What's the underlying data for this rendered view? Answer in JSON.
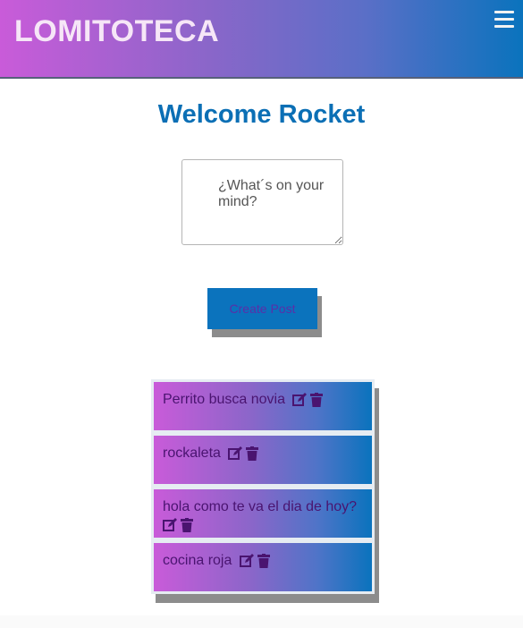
{
  "header": {
    "brand": "LOMITOTECA"
  },
  "welcome": "Welcome Rocket",
  "composer": {
    "placeholder": "¿What´s on your mind?"
  },
  "create_button": "Create Post",
  "posts": [
    {
      "title": "Perrito busca novia"
    },
    {
      "title": "rockaleta"
    },
    {
      "title": "hola como te va el dia de hoy?"
    },
    {
      "title": "cocina roja"
    }
  ],
  "colors": {
    "header_gradient": [
      "#c95bd9",
      "#0a73bd"
    ],
    "title": "#0b6fb5",
    "button": "#0b73bd",
    "post_text": "#4a1470"
  },
  "icons": [
    "menu-icon",
    "edit-icon",
    "trash-icon"
  ]
}
